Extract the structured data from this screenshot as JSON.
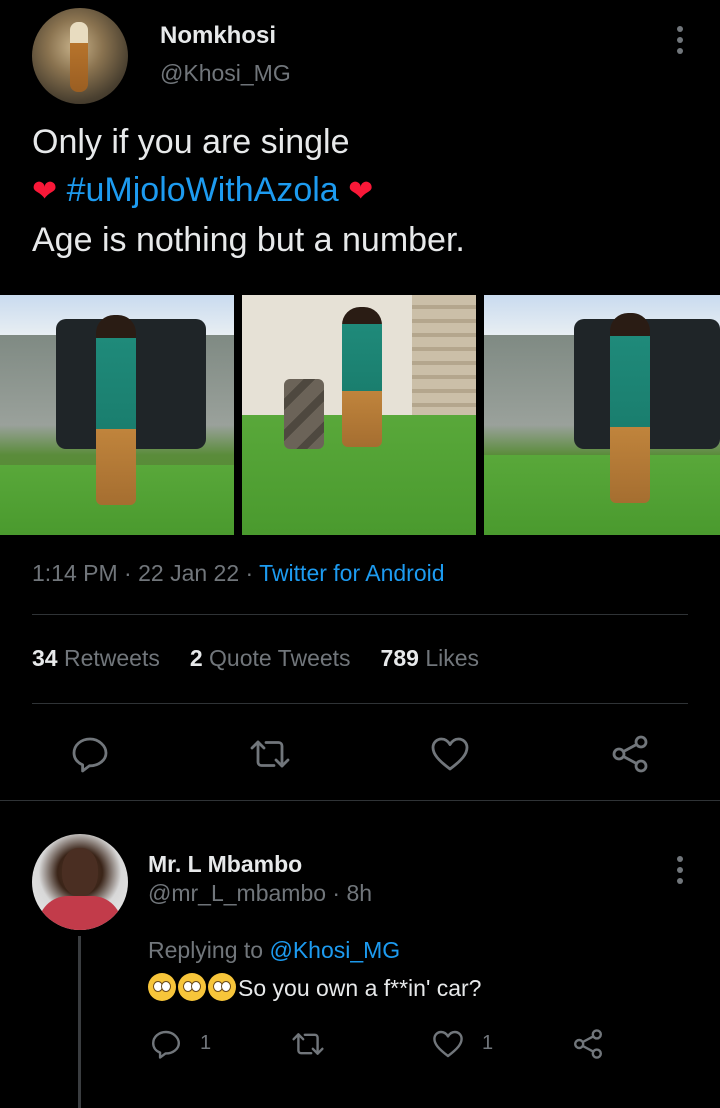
{
  "tweet": {
    "author_name": "Nomkhosi",
    "author_handle": "@Khosi_MG",
    "text_line1": "Only if you are single",
    "hashtag": "#uMjoloWithAzola",
    "heart_glyph": "❤",
    "text_line3": "Age is nothing but a number.",
    "time": "1:14 PM",
    "separator": " · ",
    "date": "22 Jan 22",
    "source": "Twitter for Android",
    "photos_count": 3
  },
  "stats": {
    "retweets_count": "34",
    "retweets_label": "Retweets",
    "quotes_count": "2",
    "quotes_label": "Quote Tweets",
    "likes_count": "789",
    "likes_label": "Likes"
  },
  "actions": [
    "reply-icon",
    "retweet-icon",
    "like-icon",
    "share-icon"
  ],
  "reply": {
    "author_name": "Mr. L Mbambo",
    "author_handle": "@mr_L_mbambo",
    "time_ago": "8h",
    "replying_prefix": "Replying to",
    "replying_mention": "@Khosi_MG",
    "text": "So you own a f**in' car?",
    "emoji_count": 3,
    "reply_count": "1",
    "like_count": "1"
  },
  "colors": {
    "background": "#000000",
    "text_primary": "#e7e9ea",
    "text_secondary": "#71767b",
    "accent": "#1d9bf0",
    "heart": "#f91838",
    "divider": "#2f3336"
  }
}
